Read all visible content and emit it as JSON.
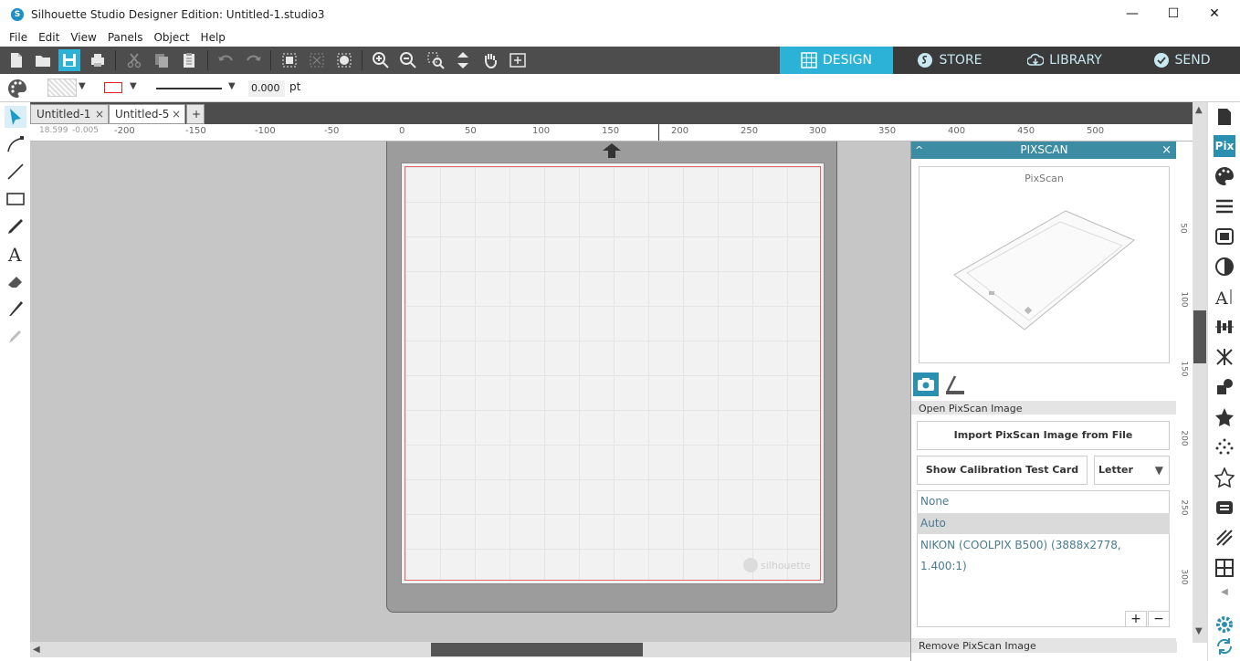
{
  "window": {
    "title": "Silhouette Studio Designer Edition: Untitled-1.studio3",
    "minimize": "—",
    "maximize": "☐",
    "close": "✕"
  },
  "menu": [
    "File",
    "Edit",
    "View",
    "Panels",
    "Object",
    "Help"
  ],
  "nav_tabs": [
    {
      "label": "DESIGN",
      "active": true
    },
    {
      "label": "STORE",
      "active": false
    },
    {
      "label": "LIBRARY",
      "active": false
    },
    {
      "label": "SEND",
      "active": false
    }
  ],
  "props": {
    "line_width": "0.000",
    "line_unit": "pt"
  },
  "doc_tabs": [
    {
      "label": "Untitled-1",
      "close": "×"
    },
    {
      "label": "Untitled-5",
      "close": "×"
    }
  ],
  "add_tab": "+",
  "coords": {
    "x": "18.599",
    "y": "-0.005"
  },
  "ruler_labels": [
    "-200",
    "-150",
    "-100",
    "-50",
    "0",
    "50",
    "100",
    "150",
    "200",
    "250",
    "300",
    "350",
    "400",
    "450",
    "500"
  ],
  "vruler_labels": [
    "50",
    "100",
    "150",
    "200",
    "250",
    "300"
  ],
  "watermark": "silhouette",
  "pixscan": {
    "title": "PIXSCAN",
    "close": "×",
    "preview_label": "PixScan",
    "open_label": "Open PixScan Image",
    "import_button": "Import PixScan Image from File",
    "calibration_button": "Show Calibration Test Card",
    "paper_size": "Letter",
    "profiles": [
      "None",
      "Auto",
      "NIKON (COOLPIX B500) (3888x2778, 1.400:1)"
    ],
    "selected_profile": "Auto",
    "add": "+",
    "remove": "−",
    "remove_label": "Remove PixScan Image"
  },
  "colors": {
    "accent": "#2bb2d6",
    "toolbar": "#4d4d4d",
    "panel_header": "#3c8da3",
    "cut_line": "#e46a6a"
  }
}
